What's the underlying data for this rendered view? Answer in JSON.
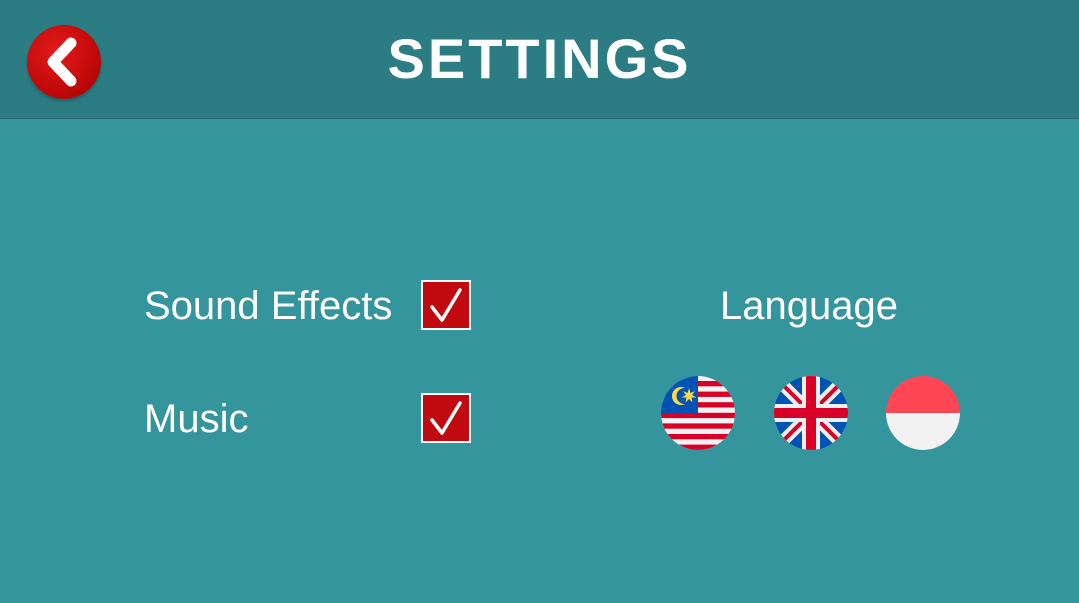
{
  "header": {
    "title": "SETTINGS",
    "back_icon": "chevron-left-icon"
  },
  "options": {
    "sound_effects": {
      "label": "Sound Effects",
      "checked": true
    },
    "music": {
      "label": "Music",
      "checked": true
    }
  },
  "language": {
    "label": "Language",
    "flags": [
      "malaysia-flag-icon",
      "uk-flag-icon",
      "indonesia-flag-icon"
    ]
  },
  "colors": {
    "background": "#35959c",
    "header": "#2b7d83",
    "accent_red": "#c00a10"
  }
}
